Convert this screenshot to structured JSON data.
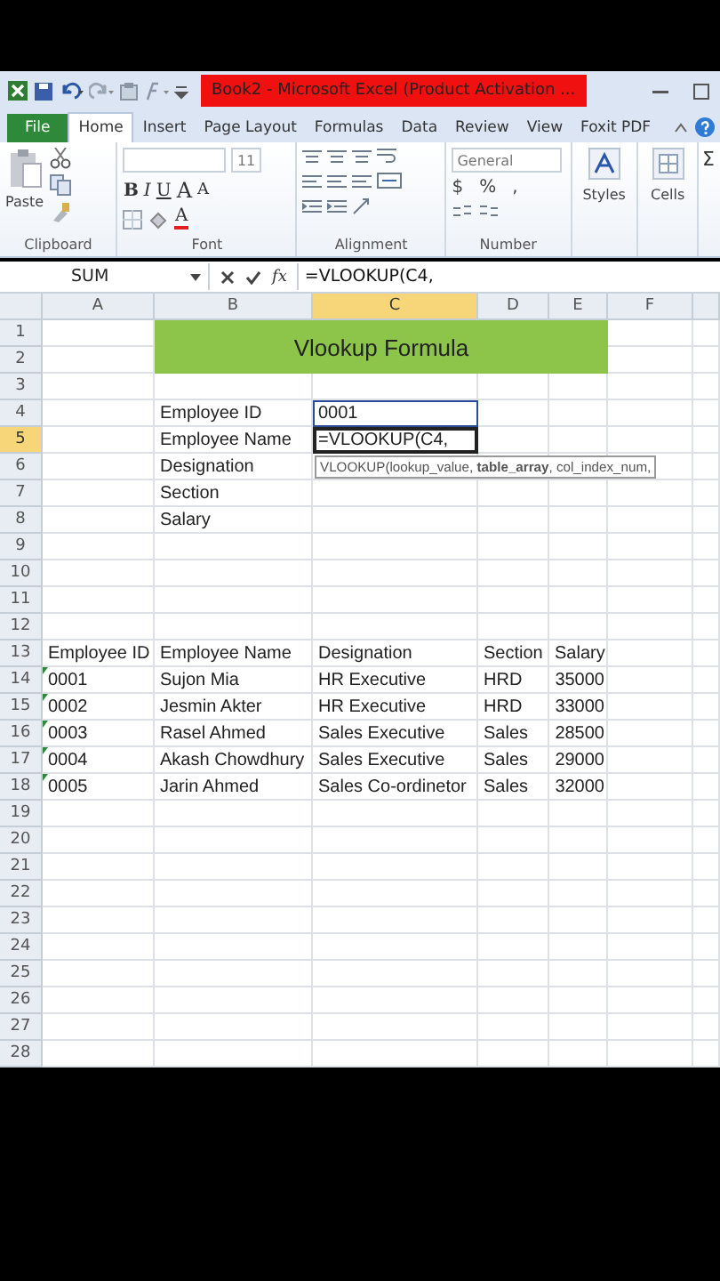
{
  "title_bar": {
    "title": "Book2 - Microsoft Excel (Product Activation ..."
  },
  "tabs": [
    {
      "label": "File",
      "kind": "file",
      "selected": false
    },
    {
      "label": "Home",
      "kind": "tab",
      "selected": true
    },
    {
      "label": "Insert",
      "kind": "tab",
      "selected": false
    },
    {
      "label": "Page Layout",
      "kind": "tab",
      "selected": false
    },
    {
      "label": "Formulas",
      "kind": "tab",
      "selected": false
    },
    {
      "label": "Data",
      "kind": "tab",
      "selected": false
    },
    {
      "label": "Review",
      "kind": "tab",
      "selected": false
    },
    {
      "label": "View",
      "kind": "tab",
      "selected": false
    },
    {
      "label": "Foxit PDF",
      "kind": "tab",
      "selected": false
    }
  ],
  "ribbon": {
    "clipboard": {
      "label": "Clipboard",
      "paste": "Paste"
    },
    "font": {
      "label": "Font",
      "size": "11",
      "bold": "B",
      "italic": "I",
      "underline": "U",
      "grow": "A",
      "shrink": "A",
      "text_color": "A"
    },
    "alignment": {
      "label": "Alignment"
    },
    "number": {
      "label": "Number",
      "format": "General",
      "currency": "$",
      "percent": "%",
      "comma": ","
    },
    "styles": {
      "label": "Styles"
    },
    "cells": {
      "label": "Cells"
    },
    "editing": {
      "sum": "Σ"
    }
  },
  "formula_bar": {
    "name_box": "SUM",
    "fx": "fx",
    "formula": "=VLOOKUP(C4,"
  },
  "sheet": {
    "columns": [
      {
        "label": "A",
        "selected": false
      },
      {
        "label": "B",
        "selected": false
      },
      {
        "label": "C",
        "selected": true
      },
      {
        "label": "D",
        "selected": false
      },
      {
        "label": "E",
        "selected": false
      },
      {
        "label": "F",
        "selected": false
      }
    ],
    "rows": [
      {
        "label": "1",
        "selected": false,
        "cells": {
          "B": {
            "value": "Vlookup Formula",
            "kind": "banner"
          }
        }
      },
      {
        "label": "2",
        "selected": false,
        "cells": {}
      },
      {
        "label": "3",
        "selected": false,
        "cells": {}
      },
      {
        "label": "4",
        "selected": false,
        "cells": {
          "B": {
            "value": "Employee ID",
            "kind": "text"
          },
          "C": {
            "value": "0001",
            "kind": "text",
            "referenced": true
          }
        }
      },
      {
        "label": "5",
        "selected": true,
        "cells": {
          "B": {
            "value": "Employee Name",
            "kind": "text"
          },
          "C": {
            "value": "=VLOOKUP(C4,",
            "kind": "text",
            "editing": true
          }
        }
      },
      {
        "label": "6",
        "selected": false,
        "cells": {
          "B": {
            "value": "Designation",
            "kind": "text"
          }
        }
      },
      {
        "label": "7",
        "selected": false,
        "cells": {
          "B": {
            "value": "Section",
            "kind": "text"
          }
        }
      },
      {
        "label": "8",
        "selected": false,
        "cells": {
          "B": {
            "value": "Salary",
            "kind": "text"
          }
        }
      },
      {
        "label": "9",
        "selected": false,
        "cells": {}
      },
      {
        "label": "10",
        "selected": false,
        "cells": {}
      },
      {
        "label": "11",
        "selected": false,
        "cells": {}
      },
      {
        "label": "12",
        "selected": false,
        "cells": {}
      },
      {
        "label": "13",
        "selected": false,
        "cells": {
          "A": {
            "value": "Employee ID",
            "kind": "text"
          },
          "B": {
            "value": "Employee Name",
            "kind": "text"
          },
          "C": {
            "value": "Designation",
            "kind": "text"
          },
          "D": {
            "value": "Section",
            "kind": "text"
          },
          "E": {
            "value": "Salary",
            "kind": "text"
          }
        }
      },
      {
        "label": "14",
        "selected": false,
        "cells": {
          "A": {
            "value": "0001",
            "kind": "text",
            "flagged": true
          },
          "B": {
            "value": "Sujon Mia",
            "kind": "text"
          },
          "C": {
            "value": "HR Executive",
            "kind": "text"
          },
          "D": {
            "value": "HRD",
            "kind": "text"
          },
          "E": {
            "value": "35000",
            "kind": "number"
          }
        }
      },
      {
        "label": "15",
        "selected": false,
        "cells": {
          "A": {
            "value": "0002",
            "kind": "text",
            "flagged": true
          },
          "B": {
            "value": "Jesmin Akter",
            "kind": "text"
          },
          "C": {
            "value": "HR Executive",
            "kind": "text"
          },
          "D": {
            "value": "HRD",
            "kind": "text"
          },
          "E": {
            "value": "33000",
            "kind": "number"
          }
        }
      },
      {
        "label": "16",
        "selected": false,
        "cells": {
          "A": {
            "value": "0003",
            "kind": "text",
            "flagged": true
          },
          "B": {
            "value": "Rasel Ahmed",
            "kind": "text"
          },
          "C": {
            "value": "Sales Executive",
            "kind": "text"
          },
          "D": {
            "value": "Sales",
            "kind": "text"
          },
          "E": {
            "value": "28500",
            "kind": "number"
          }
        }
      },
      {
        "label": "17",
        "selected": false,
        "cells": {
          "A": {
            "value": "0004",
            "kind": "text",
            "flagged": true
          },
          "B": {
            "value": "Akash Chowdhury",
            "kind": "text"
          },
          "C": {
            "value": "Sales Executive",
            "kind": "text"
          },
          "D": {
            "value": "Sales",
            "kind": "text"
          },
          "E": {
            "value": "29000",
            "kind": "number"
          }
        }
      },
      {
        "label": "18",
        "selected": false,
        "cells": {
          "A": {
            "value": "0005",
            "kind": "text",
            "flagged": true
          },
          "B": {
            "value": "Jarin Ahmed",
            "kind": "text"
          },
          "C": {
            "value": "Sales Co-ordinetor",
            "kind": "text"
          },
          "D": {
            "value": "Sales",
            "kind": "text"
          },
          "E": {
            "value": "32000",
            "kind": "number"
          }
        }
      },
      {
        "label": "19",
        "selected": false,
        "cells": {}
      },
      {
        "label": "20",
        "selected": false,
        "cells": {}
      },
      {
        "label": "21",
        "selected": false,
        "cells": {}
      },
      {
        "label": "22",
        "selected": false,
        "cells": {}
      },
      {
        "label": "23",
        "selected": false,
        "cells": {}
      },
      {
        "label": "24",
        "selected": false,
        "cells": {}
      },
      {
        "label": "25",
        "selected": false,
        "cells": {}
      },
      {
        "label": "26",
        "selected": false,
        "cells": {}
      },
      {
        "label": "27",
        "selected": false,
        "cells": {}
      },
      {
        "label": "28",
        "selected": false,
        "cells": {}
      }
    ],
    "tooltip": {
      "text": "VLOOKUP(lookup_value, **table_array**, col_index_num,"
    }
  }
}
